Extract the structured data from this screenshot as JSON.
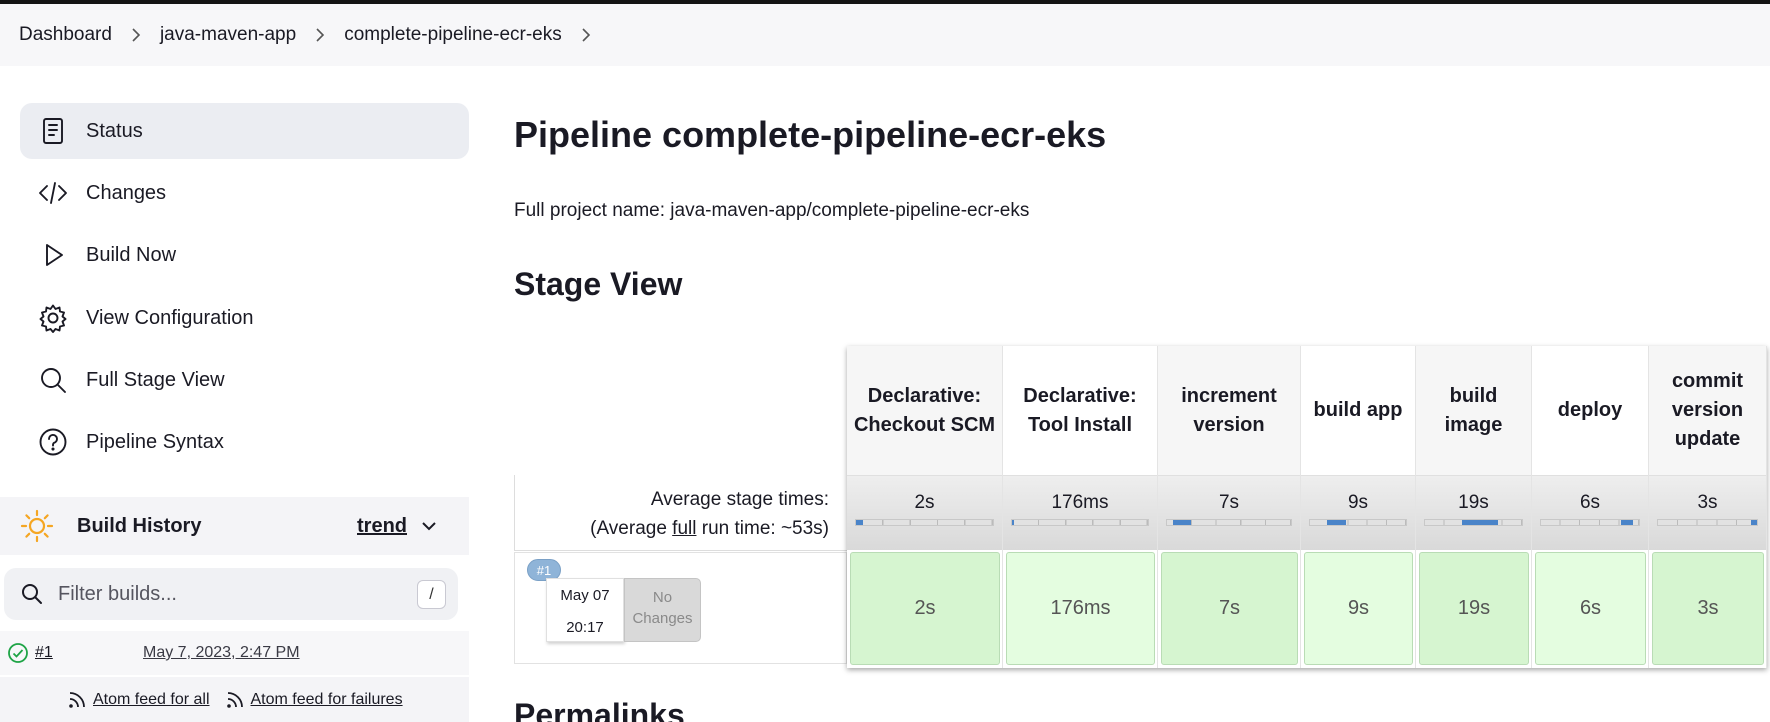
{
  "breadcrumbs": [
    "Dashboard",
    "java-maven-app",
    "complete-pipeline-ecr-eks"
  ],
  "sidebar": {
    "tasks": [
      {
        "label": "Status",
        "icon": "status-icon",
        "active": true
      },
      {
        "label": "Changes",
        "icon": "code-icon",
        "active": false
      },
      {
        "label": "Build Now",
        "icon": "play-icon",
        "active": false
      },
      {
        "label": "View Configuration",
        "icon": "gear-icon",
        "active": false
      },
      {
        "label": "Full Stage View",
        "icon": "search-icon",
        "active": false
      },
      {
        "label": "Pipeline Syntax",
        "icon": "help-icon",
        "active": false
      }
    ],
    "build_history": {
      "title": "Build History",
      "trend": "trend",
      "filter_placeholder": "Filter builds...",
      "filter_shortcut": "/",
      "builds": [
        {
          "number": "#1",
          "date": "May 7, 2023, 2:47 PM",
          "status": "success"
        }
      ],
      "feeds": [
        "Atom feed for all",
        "Atom feed for failures"
      ]
    }
  },
  "main": {
    "title": "Pipeline complete-pipeline-ecr-eks",
    "full_name": "Full project name: java-maven-app/complete-pipeline-ecr-eks",
    "stage_view_title": "Stage View",
    "permalinks_title": "Permalinks",
    "avg_label": "Average stage times:",
    "avg_full_prefix": "(Average ",
    "avg_full_link": "full",
    "avg_full_suffix": " run time: ~53s)",
    "run": {
      "badge": "#1",
      "date": "May 07",
      "time": "20:17",
      "no_changes": "No Changes"
    },
    "stages": [
      {
        "name": "Declarative: Checkout SCM",
        "avg": "2s",
        "run": "2s",
        "bar_start": 0.0,
        "bar_fraction": 0.05,
        "cell_color": "#d6f5d0"
      },
      {
        "name": "Declarative: Tool Install",
        "avg": "176ms",
        "run": "176ms",
        "bar_start": 0.0,
        "bar_fraction": 0.01,
        "cell_color": "#e4fde0"
      },
      {
        "name": "increment version",
        "avg": "7s",
        "run": "7s",
        "bar_start": 0.05,
        "bar_fraction": 0.14,
        "cell_color": "#d6f5d0"
      },
      {
        "name": "build app",
        "avg": "9s",
        "run": "9s",
        "bar_start": 0.18,
        "bar_fraction": 0.2,
        "cell_color": "#e4fde0"
      },
      {
        "name": "build image",
        "avg": "19s",
        "run": "19s",
        "bar_start": 0.38,
        "bar_fraction": 0.37,
        "cell_color": "#d6f5d0"
      },
      {
        "name": "deploy",
        "avg": "6s",
        "run": "6s",
        "bar_start": 0.82,
        "bar_fraction": 0.12,
        "cell_color": "#e4fde0"
      },
      {
        "name": "commit version update",
        "avg": "3s",
        "run": "3s",
        "bar_start": 0.94,
        "bar_fraction": 0.06,
        "cell_color": "#d6f5d0"
      }
    ]
  }
}
